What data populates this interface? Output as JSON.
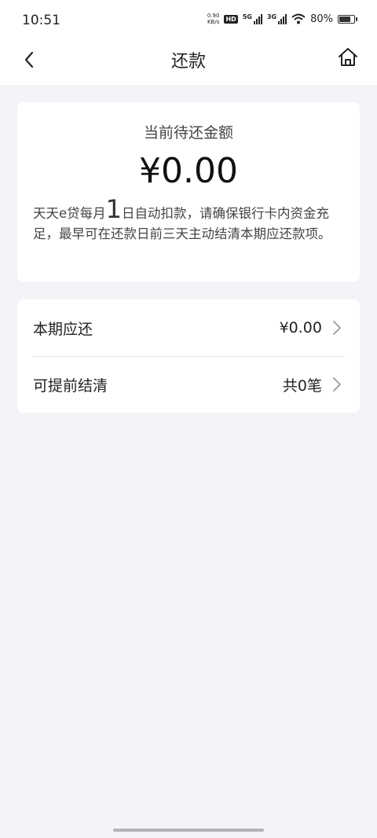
{
  "status_bar": {
    "time": "10:51",
    "net_speed_value": "0.90",
    "net_speed_unit": "KB/s",
    "hd_badge": "HD",
    "signal_1_label": "5G",
    "signal_2_label": "3G",
    "battery": "80%",
    "battery_level": 0.8
  },
  "nav": {
    "title": "还款",
    "back_icon": "chevron-left-icon",
    "home_icon": "home-icon"
  },
  "summary": {
    "label": "当前待还金额",
    "amount": "¥0.00",
    "notice_prefix": "天天e贷每月",
    "notice_day": "1",
    "notice_suffix": "日自动扣款，请确保银行卡内资金充足，最早可在还款日前三天主动结清本期应还款项。"
  },
  "rows": [
    {
      "label": "本期应还",
      "value": "¥0.00"
    },
    {
      "label": "可提前结清",
      "value": "共0笔"
    }
  ]
}
